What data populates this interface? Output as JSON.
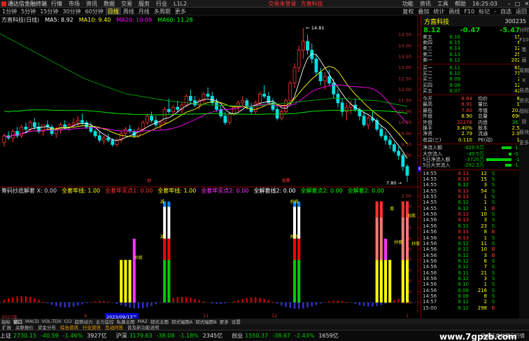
{
  "menubar": {
    "app_title": "通达信金融终端",
    "items": [
      "行情",
      "市场",
      "资讯",
      "数据",
      "交易",
      "服务",
      "行业",
      "L1L2"
    ],
    "promo": [
      "交易未登录",
      "方直科技"
    ],
    "right_items": [
      "功能",
      "资讯",
      "工具",
      "帮助"
    ],
    "clock": "16:25:03"
  },
  "toolbar": {
    "periods": [
      "1分钟",
      "5分钟",
      "15分钟",
      "30分钟",
      "60分钟",
      "日线",
      "周线",
      "月线",
      "多周期",
      "更多"
    ],
    "active_period": "日线",
    "right_items": [
      "复权",
      "叠加",
      "统计",
      "画线",
      "F10",
      "标记",
      "-",
      "自选",
      "返回"
    ]
  },
  "chart_tag": {
    "title": "方直科技(日线)",
    "ma": [
      "MA5: 8.92",
      "MA10: 9.40",
      "MA20: 10.09",
      "MA60: 11.28"
    ],
    "ma_colors": [
      "#ffffff",
      "#ffff00",
      "#ff00ff",
      "#00ff00"
    ]
  },
  "indicator_tag": {
    "title": "筹码抄底解套 X: 0.00",
    "items": [
      {
        "t": "全套牢线: 1.00",
        "c": "#ffff00"
      },
      {
        "t": "全套牢买点1: 0.00",
        "c": "#ff3333"
      },
      {
        "t": "全套牢线: 1.00",
        "c": "#ffff00"
      },
      {
        "t": "全套牢买点2: 0.00",
        "c": "#ff33ff"
      },
      {
        "t": "全解套线2: 0.00",
        "c": "#ffffff"
      },
      {
        "t": "全解套点2: 0.00",
        "c": "#00ff00"
      },
      {
        "t": "全解套2: 0.00",
        "c": "#00ff00"
      }
    ]
  },
  "chart_data": {
    "type": "candlestick",
    "high_label": "14.81",
    "low_label": "7.80",
    "price_ticks": [
      "14.50",
      "14.00",
      "13.50",
      "13.00",
      "12.50",
      "12.00",
      "11.50",
      "11.00",
      "10.50",
      "10.00",
      "9.50",
      "9.00"
    ],
    "current_price_tag": "8.39",
    "candles": [
      [
        9.6,
        10.0,
        9.4,
        9.9
      ],
      [
        9.9,
        10.1,
        9.7,
        9.8
      ],
      [
        9.8,
        10.2,
        9.6,
        10.1
      ],
      [
        10.1,
        10.3,
        9.8,
        9.9
      ],
      [
        9.9,
        10.4,
        9.8,
        10.3
      ],
      [
        10.3,
        10.5,
        10.0,
        10.2
      ],
      [
        10.2,
        10.6,
        10.1,
        10.5
      ],
      [
        10.5,
        10.7,
        10.2,
        10.3
      ],
      [
        10.3,
        10.5,
        10.0,
        10.1
      ],
      [
        10.1,
        10.4,
        9.9,
        10.4
      ],
      [
        10.4,
        10.6,
        10.2,
        10.3
      ],
      [
        10.3,
        10.4,
        9.9,
        10.0
      ],
      [
        10.0,
        10.3,
        9.8,
        10.2
      ],
      [
        10.2,
        10.5,
        10.0,
        10.4
      ],
      [
        10.4,
        10.6,
        10.2,
        10.3
      ],
      [
        10.3,
        10.5,
        10.1,
        10.4
      ],
      [
        10.4,
        10.7,
        10.3,
        10.5
      ],
      [
        10.5,
        10.8,
        10.3,
        10.6
      ],
      [
        10.6,
        10.9,
        10.4,
        10.5
      ],
      [
        10.5,
        10.6,
        10.2,
        10.3
      ],
      [
        10.3,
        10.5,
        10.0,
        10.1
      ],
      [
        10.1,
        10.2,
        9.8,
        9.9
      ],
      [
        9.9,
        10.1,
        9.6,
        9.7
      ],
      [
        9.7,
        9.9,
        9.5,
        9.8
      ],
      [
        9.8,
        10.0,
        9.6,
        9.7
      ],
      [
        9.7,
        9.8,
        9.4,
        9.5
      ],
      [
        9.5,
        9.8,
        9.4,
        9.7
      ],
      [
        9.7,
        10.1,
        9.6,
        10.0
      ],
      [
        10.0,
        10.3,
        9.9,
        10.2
      ],
      [
        10.2,
        10.4,
        10.0,
        10.1
      ],
      [
        10.1,
        10.2,
        9.8,
        9.9
      ],
      [
        9.9,
        10.3,
        9.8,
        10.2
      ],
      [
        10.2,
        10.6,
        10.1,
        10.5
      ],
      [
        10.5,
        10.9,
        10.4,
        10.8
      ],
      [
        10.8,
        11.0,
        10.5,
        10.6
      ],
      [
        10.6,
        10.8,
        10.3,
        10.4
      ],
      [
        10.4,
        10.6,
        10.2,
        10.5
      ],
      [
        10.5,
        11.2,
        10.4,
        11.1
      ],
      [
        11.1,
        11.6,
        10.9,
        11.0
      ],
      [
        11.0,
        11.3,
        10.8,
        11.2
      ],
      [
        11.2,
        11.5,
        11.0,
        11.1
      ],
      [
        11.1,
        11.4,
        10.9,
        11.3
      ],
      [
        11.3,
        11.8,
        11.2,
        11.7
      ],
      [
        11.7,
        12.0,
        11.4,
        11.5
      ],
      [
        11.5,
        11.7,
        11.2,
        11.3
      ],
      [
        11.3,
        11.6,
        11.1,
        11.5
      ],
      [
        11.5,
        11.9,
        11.4,
        11.8
      ],
      [
        11.8,
        12.1,
        11.6,
        11.7
      ],
      [
        11.7,
        11.9,
        11.3,
        11.4
      ],
      [
        11.4,
        11.6,
        11.0,
        11.1
      ],
      [
        11.1,
        11.3,
        10.7,
        10.8
      ],
      [
        10.8,
        11.0,
        10.4,
        10.5
      ],
      [
        10.5,
        11.0,
        10.4,
        10.9
      ],
      [
        10.9,
        11.3,
        10.8,
        11.2
      ],
      [
        11.2,
        11.5,
        11.0,
        11.4
      ],
      [
        11.4,
        11.7,
        11.2,
        11.5
      ],
      [
        11.5,
        11.6,
        11.1,
        11.2
      ],
      [
        11.2,
        11.4,
        10.9,
        11.0
      ],
      [
        11.0,
        11.5,
        10.9,
        11.4
      ],
      [
        11.4,
        11.9,
        11.3,
        11.8
      ],
      [
        11.8,
        12.2,
        11.6,
        11.7
      ],
      [
        11.7,
        11.9,
        11.3,
        11.4
      ],
      [
        11.4,
        11.6,
        11.0,
        11.1
      ],
      [
        11.1,
        11.3,
        10.6,
        10.7
      ],
      [
        10.7,
        11.1,
        10.6,
        11.0
      ],
      [
        11.0,
        11.6,
        10.9,
        11.5
      ],
      [
        11.5,
        12.4,
        11.4,
        12.3
      ],
      [
        12.3,
        13.2,
        12.1,
        13.0
      ],
      [
        13.0,
        14.0,
        12.8,
        13.8
      ],
      [
        13.8,
        14.81,
        13.4,
        14.2
      ],
      [
        14.2,
        14.5,
        13.6,
        13.8
      ],
      [
        13.8,
        14.1,
        13.2,
        13.4
      ],
      [
        13.4,
        13.6,
        12.6,
        12.8
      ],
      [
        12.8,
        13.0,
        12.2,
        12.4
      ],
      [
        12.4,
        12.8,
        12.0,
        12.6
      ],
      [
        12.6,
        12.9,
        12.2,
        12.3
      ],
      [
        12.3,
        12.5,
        11.6,
        11.8
      ],
      [
        11.8,
        12.0,
        11.2,
        11.4
      ],
      [
        11.4,
        11.6,
        10.8,
        11.0
      ],
      [
        11.0,
        11.4,
        10.6,
        11.2
      ],
      [
        11.2,
        11.5,
        10.9,
        11.3
      ],
      [
        11.3,
        11.6,
        11.0,
        11.1
      ],
      [
        11.1,
        11.2,
        10.6,
        10.8
      ],
      [
        10.8,
        11.0,
        10.3,
        10.4
      ],
      [
        10.4,
        10.8,
        10.2,
        10.7
      ],
      [
        10.7,
        11.0,
        10.5,
        10.6
      ],
      [
        10.6,
        10.7,
        10.1,
        10.2
      ],
      [
        10.2,
        10.4,
        9.8,
        9.9
      ],
      [
        9.9,
        10.1,
        9.5,
        9.7
      ],
      [
        9.7,
        9.9,
        9.3,
        9.5
      ],
      [
        9.5,
        9.6,
        9.1,
        9.2
      ],
      [
        9.2,
        9.4,
        8.8,
        9.0
      ],
      [
        9.0,
        9.1,
        8.3,
        8.5
      ],
      [
        8.5,
        8.6,
        7.8,
        8.1
      ]
    ],
    "ma_series": [
      {
        "name": "MA5",
        "color": "#ffffff"
      },
      {
        "name": "MA10",
        "color": "#ffff00"
      },
      {
        "name": "MA20",
        "color": "#ff00ff"
      },
      {
        "name": "MA60",
        "color": "#00ff00"
      }
    ],
    "ind_ticks": [
      "2.00",
      "1.80",
      "1.60",
      "1.40",
      "1.20",
      "1.00",
      "0.80",
      "0.60",
      "0.40",
      "0.20",
      "0.00"
    ],
    "ind_labels": [
      "财",
      "涨腾",
      "减",
      "减",
      "抄底",
      "抄底",
      "抄底",
      "底",
      "抄底",
      "抄底",
      "抄底"
    ],
    "time_labels": [
      "2023年",
      "9",
      "2023/09/13三",
      "11",
      "12",
      "1"
    ]
  },
  "quote": {
    "name": "方直科技",
    "code": "300235",
    "price": "8.12",
    "change": "-0.47",
    "pct": "-5.47%",
    "asks": [
      [
        "卖五",
        "8.16",
        "15"
      ],
      [
        "卖四",
        "8.15",
        "6"
      ],
      [
        "卖三",
        "8.14",
        "12"
      ],
      [
        "卖二",
        "8.13",
        "25"
      ],
      [
        "卖一",
        "8.12",
        "202"
      ]
    ],
    "bids": [
      [
        "买一",
        "8.11",
        "61"
      ],
      [
        "买二",
        "8.10",
        "71"
      ],
      [
        "买三",
        "8.09",
        "2"
      ],
      [
        "买四",
        "8.08",
        "12"
      ],
      [
        "买五",
        "8.07",
        "42"
      ]
    ],
    "stats": [
      [
        "今开",
        "8.64",
        "均价",
        "8.31"
      ],
      [
        "最高",
        "8.91",
        "量比",
        "1.29"
      ],
      [
        "最低",
        "7.80",
        "市值",
        "20.4亿"
      ],
      [
        "外盘",
        "8.90",
        "总量",
        "69070"
      ],
      [
        "外盘",
        "32278",
        "内盘",
        "36792"
      ],
      [
        "换手",
        "3.40%",
        "股本",
        "2.52亿"
      ],
      [
        "净资",
        "2.79",
        "流通",
        "2.03亿"
      ],
      [
        "收益(三)",
        "0.110",
        "PE(动)",
        "18.4"
      ]
    ],
    "flows": [
      [
        "净流入额",
        "-429.5万",
        "-1.4%"
      ],
      [
        "大宗流入",
        "-49.5万",
        "-0.2%"
      ],
      [
        "5日净流入额",
        "-3720万",
        "-15%"
      ],
      [
        "5日大宗流入",
        "-292.5万",
        "-1.2%"
      ]
    ],
    "ticks": [
      [
        "14:55",
        "8.13",
        "12",
        "S"
      ],
      [
        "14:55",
        "8.13",
        "15",
        "S"
      ],
      [
        "14:55",
        "8.12",
        "3",
        "S"
      ],
      [
        "14:55",
        "8.13",
        "54",
        "S"
      ],
      [
        "14:55",
        "8.13",
        "1",
        "S"
      ],
      [
        "14:55",
        "8.12",
        "1",
        "S"
      ],
      [
        "14:55",
        "8.12",
        "1",
        "B"
      ],
      [
        "14:56",
        "8.13",
        "10",
        "S"
      ],
      [
        "14:56",
        "8.13",
        "3",
        "S"
      ],
      [
        "14:56",
        "8.12",
        "23",
        "S"
      ],
      [
        "14:56",
        "8.13",
        "8",
        "B"
      ],
      [
        "14:56",
        "8.13",
        "1",
        "S"
      ],
      [
        "14:56",
        "8.12",
        "11",
        "S"
      ],
      [
        "14:56",
        "8.12",
        "10",
        "B"
      ],
      [
        "14:56",
        "8.12",
        "3",
        "B"
      ],
      [
        "14:56",
        "8.12",
        "6",
        "S"
      ],
      [
        "14:56",
        "8.12",
        "7",
        "S"
      ],
      [
        "14:56",
        "8.11",
        "21",
        "S"
      ],
      [
        "14:56",
        "8.12",
        "3",
        "S"
      ],
      [
        "14:56",
        "8.10",
        "1",
        "S"
      ],
      [
        "14:56",
        "8.08",
        "216",
        "S"
      ],
      [
        "14:56",
        "8.08",
        "8",
        "S"
      ],
      [
        "14:57",
        "8.12",
        "2",
        "S"
      ],
      [
        "15:00",
        "8.12",
        "298",
        "B"
      ]
    ]
  },
  "right_strip": [
    "分时",
    "F10",
    "笔",
    "画",
    "周期",
    "K",
    "自选",
    "资讯",
    "指标",
    "财",
    "板块",
    "更多"
  ],
  "tabs1": [
    "指标",
    "窗口",
    "MACD",
    "VOL-TDX",
    "CCI",
    "趋势动力",
    "主力监控",
    "私募主图",
    "MA2",
    "韧式主图",
    "韧式幅图A",
    "韧式幅图B",
    "更多",
    "设置"
  ],
  "tabs1_active": "窗口",
  "tabs2": [
    "扩展",
    "关联报价",
    "资金分布",
    "综合资讯",
    "行业资讯",
    "互动问答",
    "普及新功能说明"
  ],
  "status": [
    {
      "n": "上证",
      "p": "2730.15",
      "c": "-40.59",
      "pc": "-1.46%",
      "a": "3927亿"
    },
    {
      "n": "沪深",
      "p": "3179.63",
      "c": "-38.08",
      "pc": "-1.18%",
      "a": "2345亿"
    },
    {
      "n": "创业",
      "p": "1550.37",
      "c": "-38.67",
      "pc": "-2.43%",
      "a": "1659亿"
    }
  ],
  "status_ad": "平安证券新疆云行情",
  "watermark": "www.7gpzb.com"
}
